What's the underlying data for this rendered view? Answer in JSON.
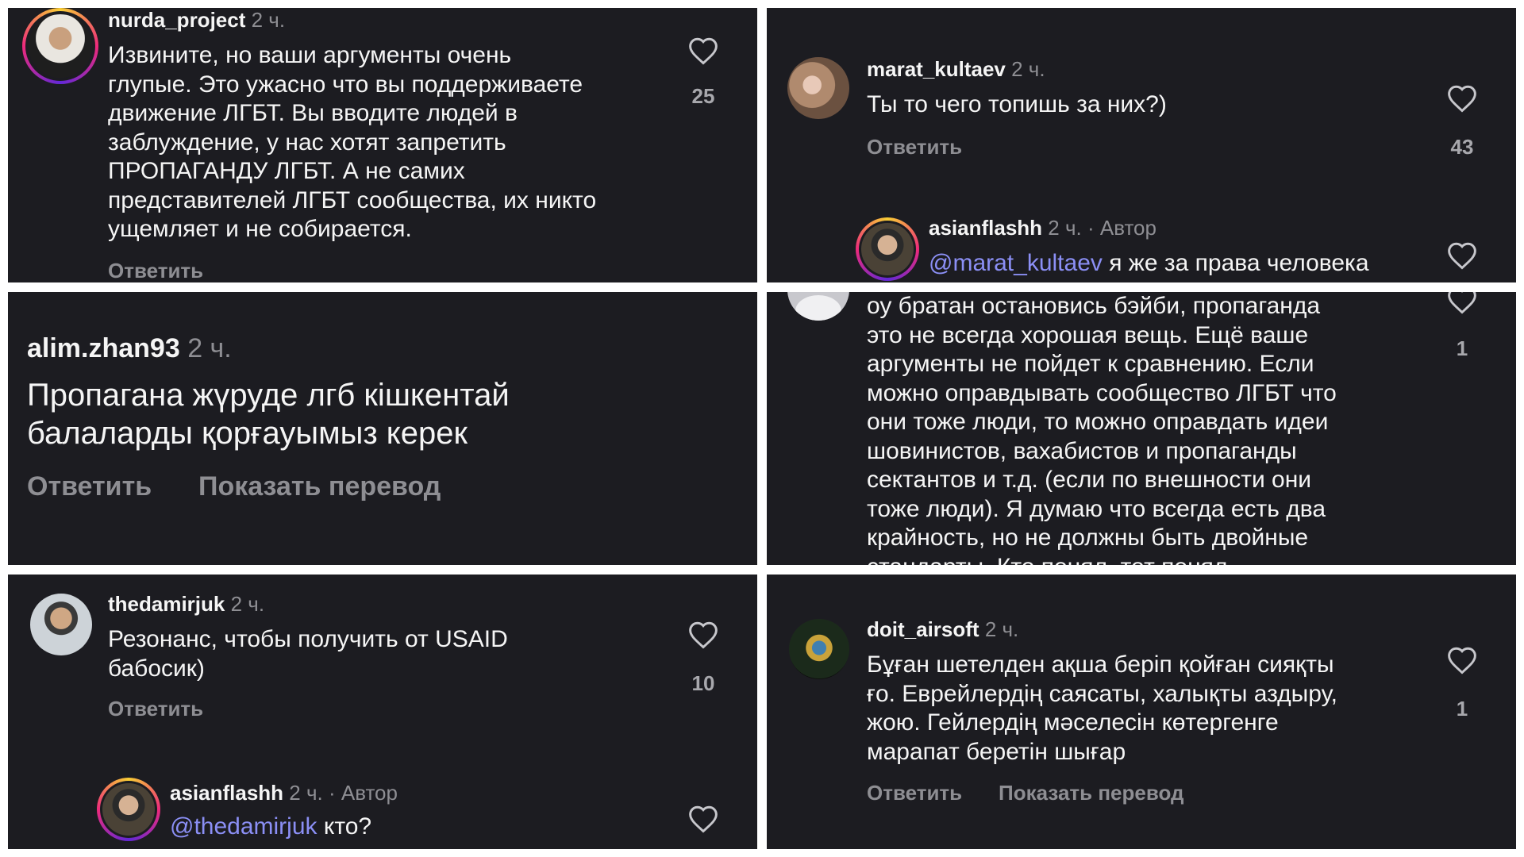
{
  "panel1": {
    "username": "nurda_project",
    "time": "2 ч.",
    "lines": [
      "Извините, но ваши аргументы очень",
      "глупые. Это ужасно что вы поддерживаете",
      "движение ЛГБТ. Вы вводите людей в",
      "заблуждение, у нас хотят запретить",
      "ПРОПАГАНДУ ЛГБТ. А не самих",
      "представителей ЛГБТ сообщества, их никто",
      "ущемляет и не собирается."
    ],
    "likes": "25",
    "reply": "Ответить"
  },
  "panel2": {
    "username": "marat_kultaev",
    "time": "2 ч.",
    "text": "Ты то чего топишь за них?)",
    "reply": "Ответить",
    "likes": "43",
    "sub": {
      "username": "asianflashh",
      "meta": "2 ч. · Автор",
      "mention": "@marat_kultaev",
      "text": " я же за права человека"
    }
  },
  "panel3": {
    "username": "alim.zhan93",
    "time": "2 ч.",
    "lines": [
      "Пропагана жүруде лгб кішкентай",
      "балаларды қорғауымыз керек"
    ],
    "reply": "Ответить",
    "translate": "Показать перевод"
  },
  "panel4": {
    "lines": [
      "оу братан остановись бэйби, пропаганда",
      "это не всегда хорошая вещь. Ещё ваше",
      "аргументы не пойдет к сравнению. Если",
      "можно оправдывать сообщество ЛГБТ что",
      "они тоже люди, то можно оправдать идеи",
      "шовинистов, вахабистов и пропаганды",
      "сектантов и т.д. (если по внешности они",
      "тоже люди). Я думаю что всегда есть два",
      "крайность, но не должны быть двойные",
      "стандарты. Кто понял, тот понял"
    ],
    "likes": "1"
  },
  "panel5": {
    "username": "thedamirjuk",
    "time": "2 ч.",
    "lines": [
      "Резонанс, чтобы получить от USAID",
      "бабосик)"
    ],
    "likes": "10",
    "reply": "Ответить",
    "sub": {
      "username": "asianflashh",
      "meta": "2 ч. · Автор",
      "mention": "@thedamirjuk",
      "text": " кто?"
    }
  },
  "panel6": {
    "username": "doit_airsoft",
    "time": "2 ч.",
    "lines": [
      "Бұған шетелден ақша беріп қойған сияқты",
      "ғо. Еврейлердің саясаты, халықты аздыру,",
      "жою. Гейлердің мәселесін көтергенге",
      "марапат беретін шығар"
    ],
    "likes": "1",
    "reply": "Ответить",
    "translate": "Показать перевод"
  },
  "colors": {
    "panel_bg": "#1c1c21",
    "text": "#f5f5f5",
    "muted": "#8e8e93",
    "mention": "#8b8ff5",
    "separator": "#ffffff"
  }
}
